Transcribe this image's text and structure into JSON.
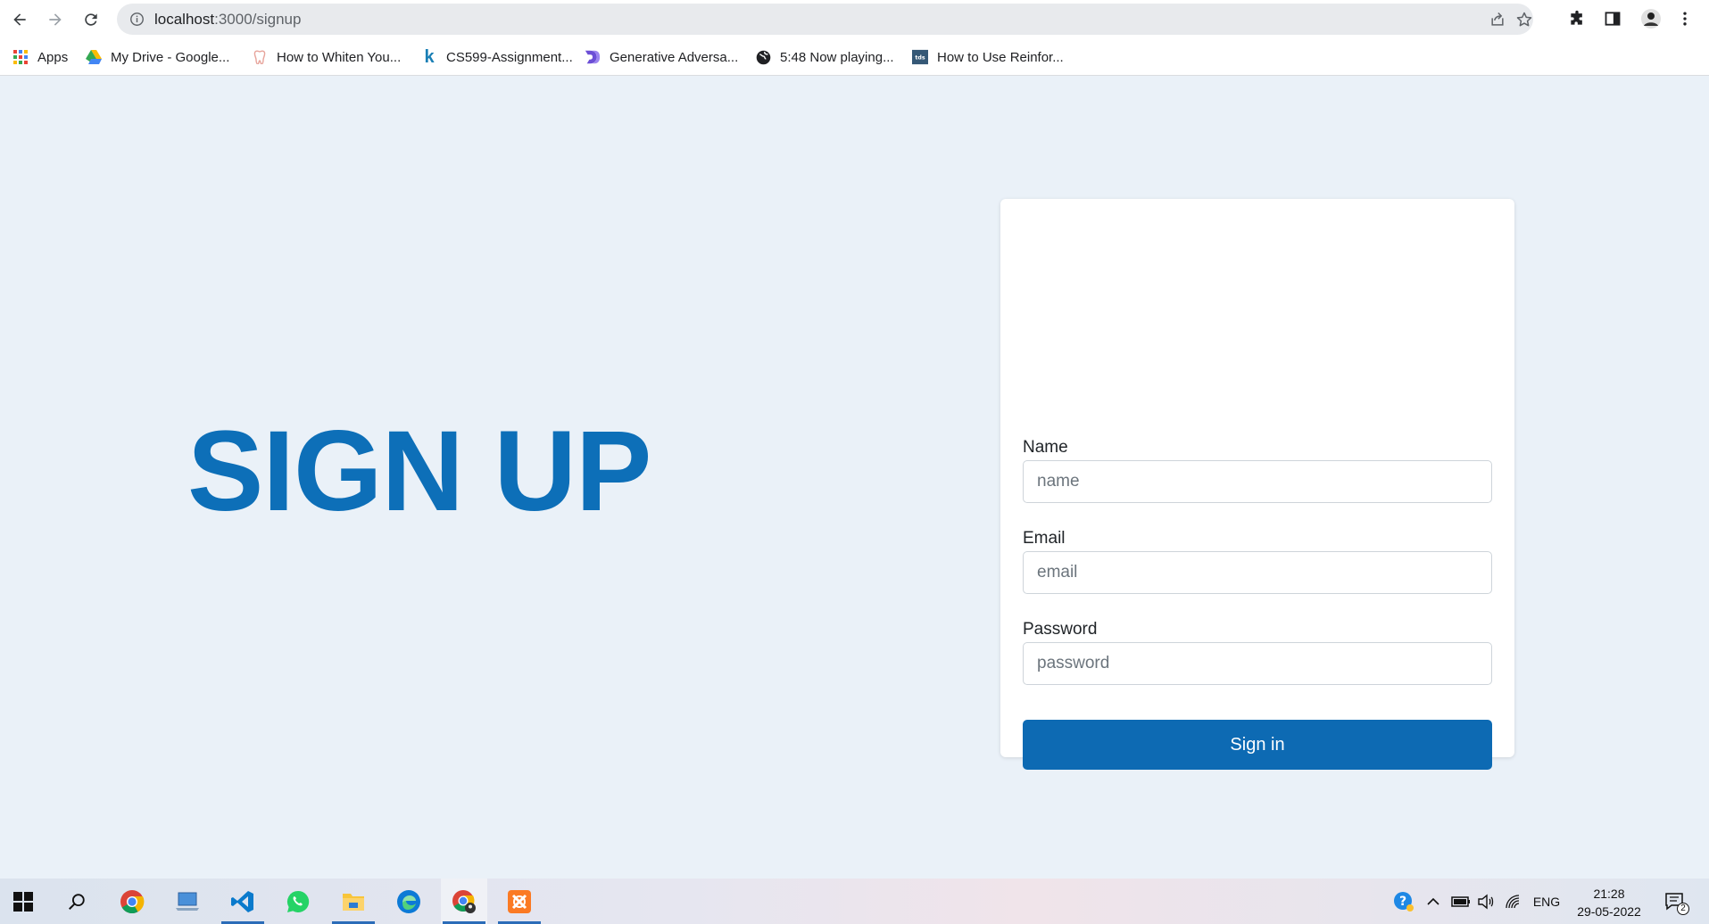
{
  "browser": {
    "url_host": "localhost",
    "url_path": ":3000/signup",
    "bookmarks": [
      {
        "label": "Apps",
        "icon": "apps-grid-icon"
      },
      {
        "label": "My Drive - Google...",
        "icon": "google-drive-icon"
      },
      {
        "label": "How to Whiten You...",
        "icon": "tooth-icon"
      },
      {
        "label": "CS599-Assignment...",
        "icon": "k-logo-icon"
      },
      {
        "label": "Generative Adversa...",
        "icon": "d-logo-icon"
      },
      {
        "label": "5:48 Now playing...",
        "icon": "globe-icon"
      },
      {
        "label": "How to Use Reinfor...",
        "icon": "tds-logo-icon"
      }
    ]
  },
  "page": {
    "hero_title": "SIGN UP",
    "form": {
      "name_label": "Name",
      "name_placeholder": "name",
      "email_label": "Email",
      "email_placeholder": "email",
      "password_label": "Password",
      "password_placeholder": "password",
      "submit_label": "Sign in"
    }
  },
  "taskbar": {
    "apps": [
      "windows-start-icon",
      "search-icon",
      "chrome-icon",
      "laptop-icon",
      "vscode-icon",
      "whatsapp-icon",
      "file-explorer-icon",
      "edge-icon",
      "chrome-profile-icon",
      "xampp-icon"
    ],
    "language": "ENG",
    "time": "21:28",
    "date": "29-05-2022",
    "notification_count": "2"
  },
  "colors": {
    "accent": "#0d6ab3",
    "hero_text": "#0d6fb8",
    "page_background": "#eaf1f8"
  }
}
